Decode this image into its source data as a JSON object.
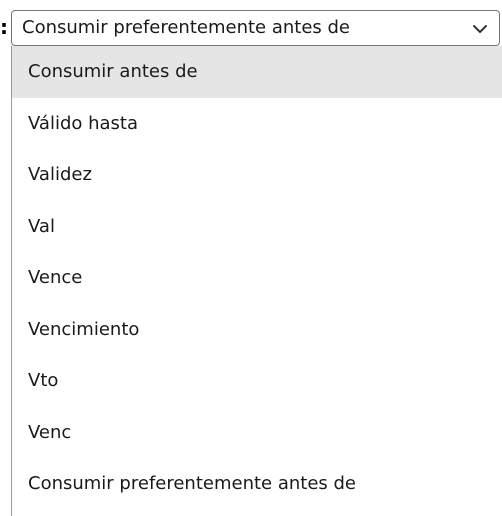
{
  "field": {
    "label_suffix": ":",
    "selected_value": "Consumir preferentemente antes de"
  },
  "dropdown": {
    "options": [
      "Consumir antes de",
      "Válido hasta",
      "Validez",
      "Val",
      "Vence",
      "Vencimiento",
      "Vto",
      "Venc",
      "Consumir preferentemente antes de"
    ],
    "highlighted_index": 0
  },
  "icons": {
    "dropdown_arrow": "chevron-down-icon"
  },
  "colors": {
    "highlight": "#e5e5e5",
    "border": "#767676"
  }
}
